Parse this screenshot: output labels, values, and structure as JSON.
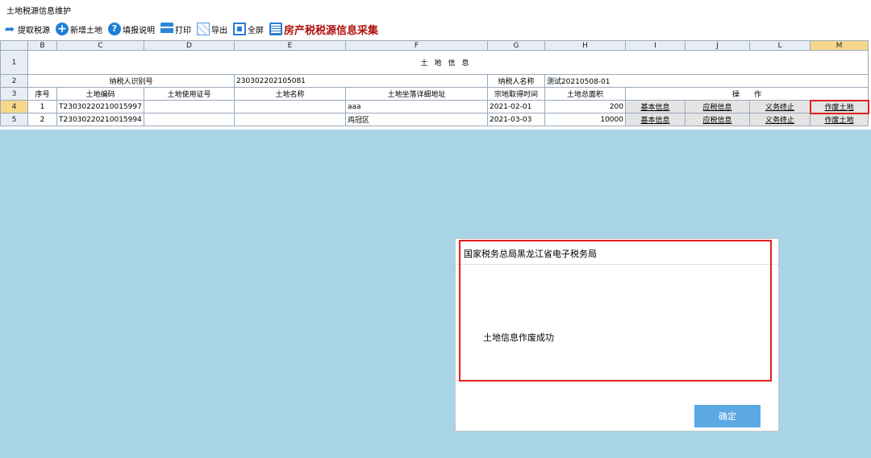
{
  "window": {
    "title": "土地税源信息维护"
  },
  "toolbar": {
    "fetch": "提取税源",
    "add": "新增土地",
    "help": "填报说明",
    "print": "打印",
    "export": "导出",
    "fullscreen": "全屏",
    "module_title": "房产税税源信息采集",
    "icons": {
      "fetch": "arrow-icon",
      "add": "plus-icon",
      "help": "help-icon",
      "print": "printer-icon",
      "export": "export-icon",
      "fullscreen": "fullscreen-icon",
      "module": "clipboard-icon"
    }
  },
  "sheet": {
    "col_letters": [
      "B",
      "C",
      "D",
      "E",
      "F",
      "G",
      "H",
      "I",
      "J",
      "L",
      "M"
    ],
    "row_numbers": [
      "1",
      "2",
      "3",
      "4",
      "5"
    ],
    "title": "土地信息",
    "taxpayer_id_label": "纳税人识别号",
    "taxpayer_id": "230302202105081",
    "taxpayer_name_label": "纳税人名称",
    "taxpayer_name": "测试20210508-01",
    "headers": {
      "seq": "序号",
      "land_code": "土地编码",
      "land_cert": "土地使用证号",
      "land_name": "土地名称",
      "address": "土地坐落详细地址",
      "acquire_date": "宗地取得时间",
      "area": "土地总面积",
      "operations": "操　　作"
    },
    "rows": [
      {
        "seq": "1",
        "code": "T23030220210015997",
        "cert": "",
        "name": "",
        "address": "aaa",
        "date": "2021-02-01",
        "area": "200"
      },
      {
        "seq": "2",
        "code": "T23030220210015994",
        "cert": "",
        "name": "",
        "address": "鸡冠区",
        "date": "2021-03-03",
        "area": "10000"
      }
    ],
    "ops": {
      "basic": "基本信息",
      "tax": "应税信息",
      "terminate": "义务终止",
      "void": "作废土地"
    }
  },
  "dialog": {
    "title": "国家税务总局黑龙江省电子税务局",
    "message": "土地信息作废成功",
    "ok": "确定"
  },
  "colors": {
    "accent_red": "#e02020",
    "background": "#a8d4e6",
    "button": "#5ba8e2"
  }
}
